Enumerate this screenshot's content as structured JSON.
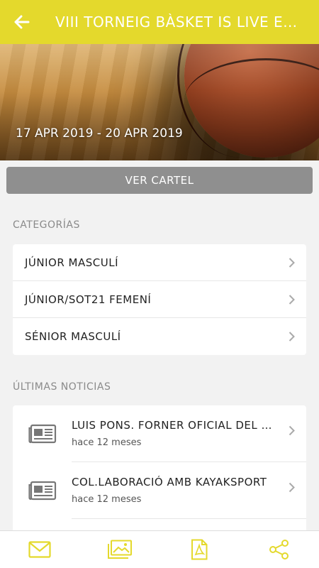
{
  "header": {
    "title": "VIII TORNEIG BÀSKET IS LIVE EXPERIENCE"
  },
  "hero": {
    "date_range": "17 APR 2019 - 20 APR 2019"
  },
  "actions": {
    "poster_button": "VER CARTEL"
  },
  "categories": {
    "heading": "CATEGORÍAS",
    "items": [
      {
        "label": "JÚNIOR MASCULÍ"
      },
      {
        "label": "JÚNIOR/SOT21 FEMENÍ"
      },
      {
        "label": "SÉNIOR MASCULÍ"
      }
    ]
  },
  "news": {
    "heading": "ÚLTIMAS NOTICIAS",
    "items": [
      {
        "title": "LUIS PONS. FORNER OFICIAL DEL TORNEIG",
        "time": "hace 12 meses"
      },
      {
        "title": "COL.LABORACIÓ AMB KAYAKSPORT",
        "time": "hace 12 meses"
      }
    ]
  },
  "bottom_nav": {
    "icons": [
      "mail-icon",
      "gallery-icon",
      "pdf-icon",
      "share-icon"
    ]
  },
  "colors": {
    "accent": "#e4d92c",
    "button_gray": "#8f8f8f",
    "background": "#f2f2f2"
  }
}
